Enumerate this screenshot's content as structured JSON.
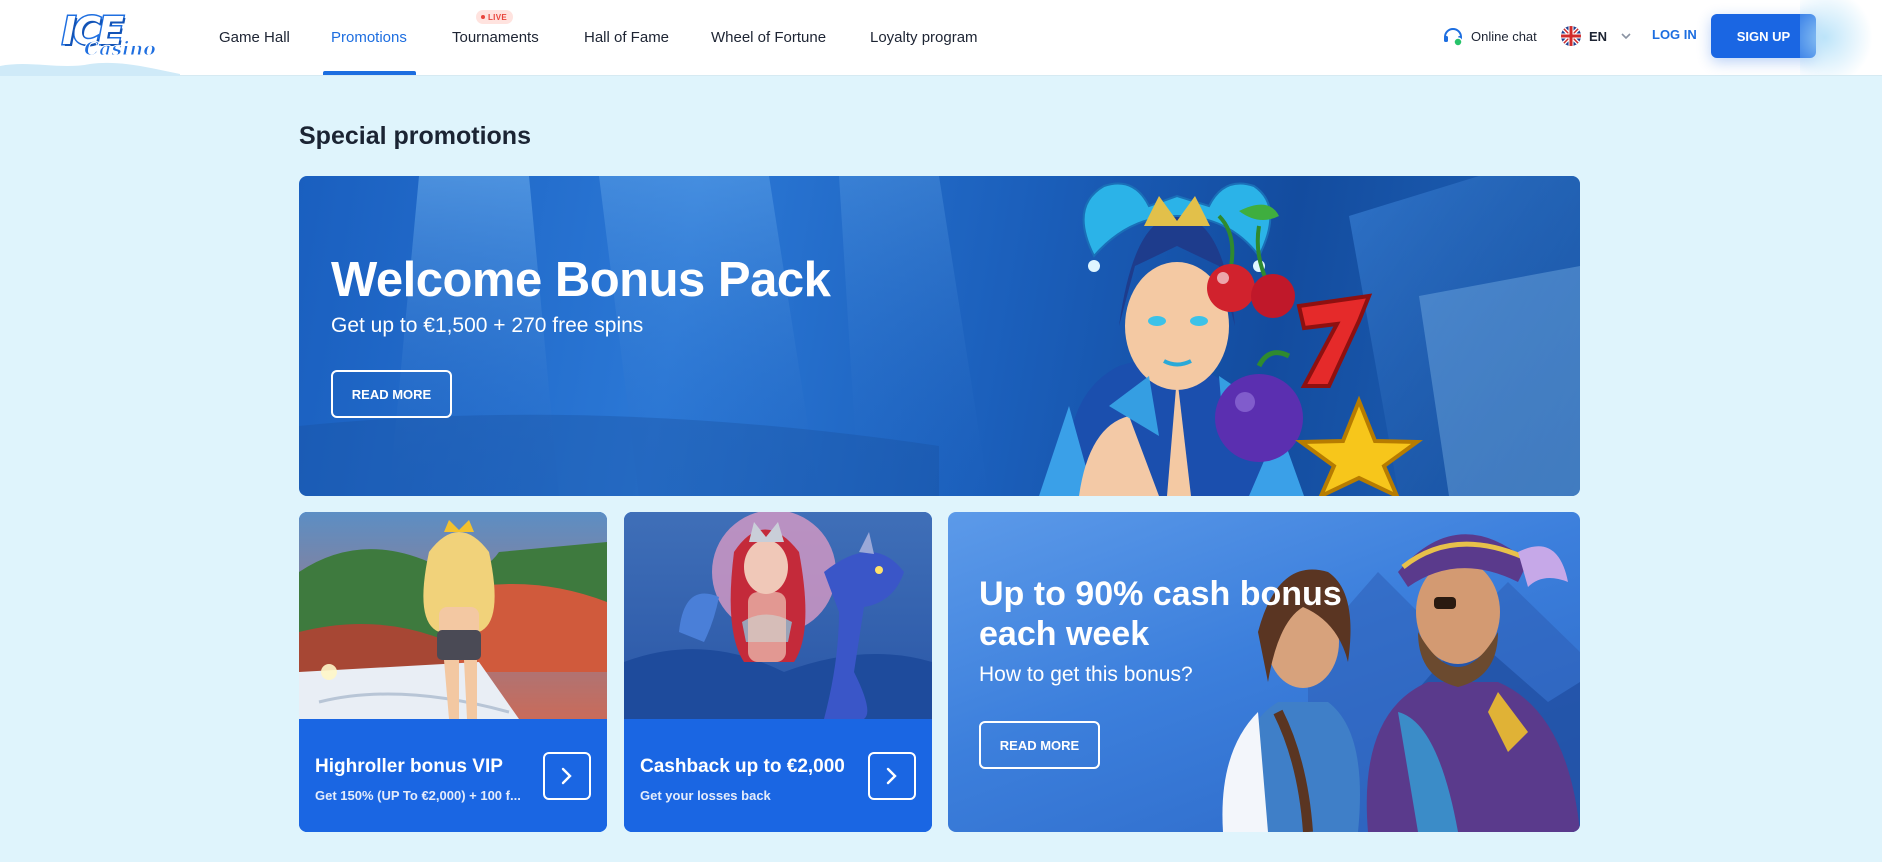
{
  "header": {
    "logo_main": "ICE",
    "logo_sub": "Casino",
    "nav": [
      {
        "label": "Game Hall"
      },
      {
        "label": "Promotions"
      },
      {
        "label": "Tournaments"
      },
      {
        "label": "Hall of Fame"
      },
      {
        "label": "Wheel of Fortune"
      },
      {
        "label": "Loyalty program"
      }
    ],
    "live_badge": "LIVE",
    "chat_label": "Online chat",
    "lang_label": "EN",
    "login_label": "LOG IN",
    "signup_label": "SIGN UP",
    "active_nav": "Promotions",
    "accent_color": "#1a66e3"
  },
  "main": {
    "title": "Special promotions",
    "hero": {
      "title": "Welcome Bonus Pack",
      "subtitle": "Get up to €1,500 + 270 free spins",
      "button": "READ MORE"
    },
    "cards": [
      {
        "title": "Highroller bonus VIP",
        "desc": "Get 150% (UP To €2,000) + 100 f..."
      },
      {
        "title": "Cashback up to €2,000",
        "desc": "Get your losses back"
      }
    ],
    "cash": {
      "title": "Up to 90% cash bonus each week",
      "subtitle": "How to get this bonus?",
      "button": "READ MORE"
    }
  }
}
